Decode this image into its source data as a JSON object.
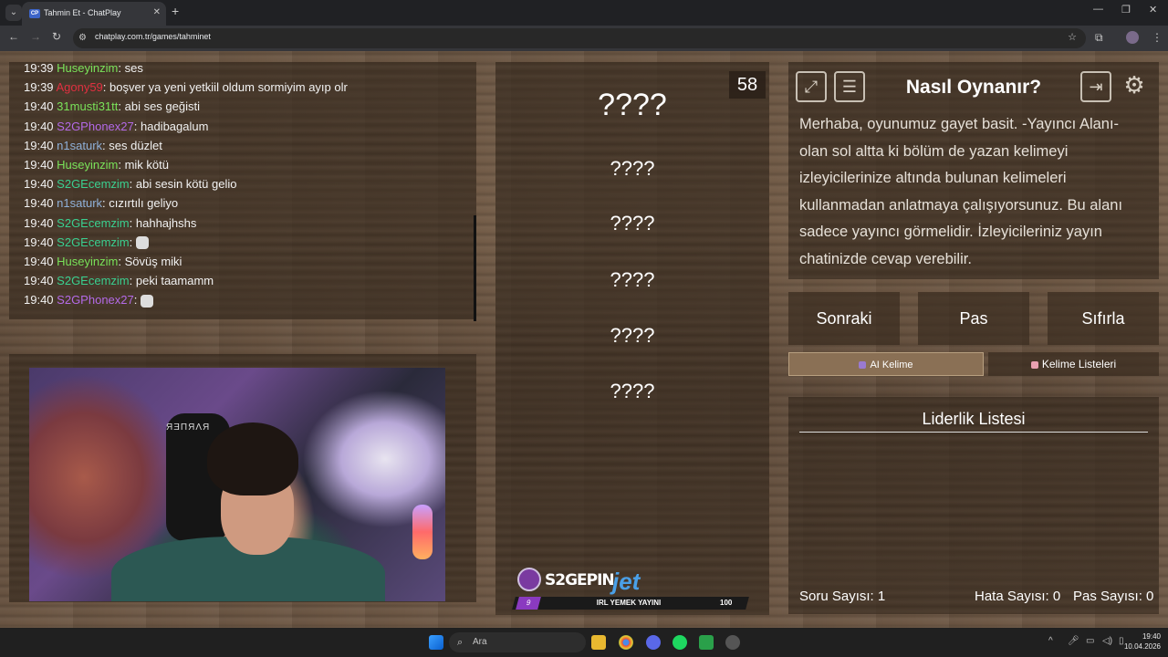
{
  "browser": {
    "tab_title": "Tahmin Et - ChatPlay",
    "favicon_text": "CP",
    "url": "chatplay.com.tr/games/tahminet"
  },
  "chat": {
    "messages": [
      {
        "time": "19:39",
        "user": "Huseyinzim",
        "text": "ses",
        "color": "#7ae35a"
      },
      {
        "time": "19:39",
        "user": "Agony59",
        "text": "boşver ya yeni yetkiil oldum sormiyim ayıp olr",
        "color": "#e03040"
      },
      {
        "time": "19:40",
        "user": "31musti31tt",
        "text": "abi ses geğisti",
        "color": "#7ae35a"
      },
      {
        "time": "19:40",
        "user": "S2GPhonex27",
        "text": "hadibagalum",
        "color": "#b46ae8"
      },
      {
        "time": "19:40",
        "user": "n1saturk",
        "text": "ses düzlet",
        "color": "#8fb0d8"
      },
      {
        "time": "19:40",
        "user": "Huseyinzim",
        "text": "mik kötü",
        "color": "#7ae35a"
      },
      {
        "time": "19:40",
        "user": "S2GEcemzim",
        "text": "abi sesin kötü gelio",
        "color": "#3ad090"
      },
      {
        "time": "19:40",
        "user": "n1saturk",
        "text": "cızırtılı geliyo",
        "color": "#8fb0d8"
      },
      {
        "time": "19:40",
        "user": "S2GEcemzim",
        "text": "hahhajhshs",
        "color": "#3ad090"
      },
      {
        "time": "19:40",
        "user": "S2GEcemzim",
        "text": "",
        "color": "#3ad090",
        "emote": true
      },
      {
        "time": "19:40",
        "user": "Huseyinzim",
        "text": "Sövüş miki",
        "color": "#7ae35a"
      },
      {
        "time": "19:40",
        "user": "S2GEcemzim",
        "text": "peki taamamm",
        "color": "#3ad090"
      },
      {
        "time": "19:40",
        "user": "S2GPhonex27",
        "text": "",
        "color": "#b46ae8",
        "emote": true
      }
    ]
  },
  "camera": {
    "chair_brand": "ЯƎΠЯΛЯ"
  },
  "game": {
    "timer": "58",
    "words": [
      "????",
      "????",
      "????",
      "????",
      "????",
      "????"
    ]
  },
  "sponsor": {
    "name": "S2GEPIN",
    "partner": "jet",
    "level": "9",
    "title": "IRL YEMEK YAYINI",
    "number": "100"
  },
  "info": {
    "title": "Nasıl Oynanır?",
    "text": "Merhaba, oyunumuz gayet basit. -Yayıncı Alanı- olan sol altta ki bölüm de yazan kelimeyi izleyicilerinize altında bulunan kelimeleri kullanmadan anlatmaya çalışıyorsunuz. Bu alanı sadece yayıncı görmelidir. İzleyicileriniz yayın chatinizde cevap verebilir."
  },
  "controls": {
    "next": "Sonraki",
    "pass": "Pas",
    "reset": "Sıfırla",
    "ai_word": "AI Kelime",
    "word_lists": "Kelime Listeleri"
  },
  "leaderboard": {
    "title": "Liderlik Listesi",
    "question_count": "Soru Sayısı: 1",
    "error_count": "Hata Sayısı: 0",
    "pass_count": "Pas Sayısı: 0"
  },
  "taskbar": {
    "search_placeholder": "Ara",
    "time": "19:40",
    "date": "10.04.2026"
  },
  "colors": {
    "panel": "#3a2c20",
    "wood": "#6b5643"
  }
}
